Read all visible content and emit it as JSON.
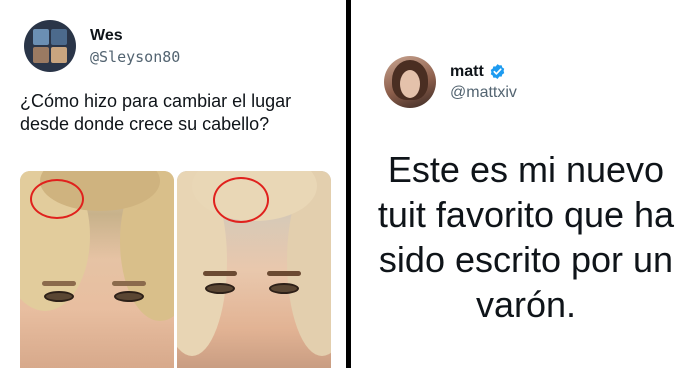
{
  "left_tweet": {
    "author": {
      "display_name": "Wes",
      "handle": "@Sleyson80"
    },
    "text": "¿Cómo hizo para cambiar el lugar desde donde crece su cabello?",
    "photos": [
      {
        "label": "photo-before"
      },
      {
        "label": "photo-after"
      }
    ]
  },
  "right_tweet": {
    "author": {
      "display_name": "matt",
      "handle": "@mattxiv",
      "verified": true
    },
    "text": "Este es mi nuevo tuit favorito que ha sido escrito por un varón."
  },
  "colors": {
    "verified_badge": "#1d9bf0",
    "handle_gray": "#536471",
    "text": "#0f1419",
    "annotation_red": "#e0211d"
  }
}
